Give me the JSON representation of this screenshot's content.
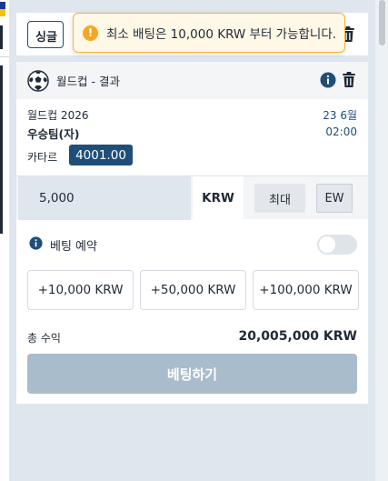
{
  "toast": {
    "icon": "warning-icon",
    "message": "최소 배팅은 10,000 KRW 부터 가능합니다."
  },
  "betslip": {
    "tab_label": "싱글",
    "card": {
      "sport_icon": "soccer-ball-icon",
      "title": "월드컵 - 결과",
      "event_name": "월드컵 2026",
      "event_date": "23 6월",
      "pick": "우승팀(자)",
      "event_time": "02:00",
      "market": "카타르",
      "odds": "4001.00"
    },
    "stake": {
      "value": "5,000",
      "currency": "KRW",
      "max_label": "최대",
      "ew_label": "EW"
    },
    "reserve": {
      "label": "베팅 예약",
      "enabled": false
    },
    "quick_amounts": [
      "+10,000 KRW",
      "+50,000 KRW",
      "+100,000 KRW"
    ],
    "total": {
      "label": "총 수익",
      "value": "20,005,000 KRW"
    },
    "place_bet_label": "베팅하기"
  },
  "colors": {
    "primary": "#1f4e79",
    "warning": "#f5a623",
    "disabled_button": "#a9bccc"
  }
}
